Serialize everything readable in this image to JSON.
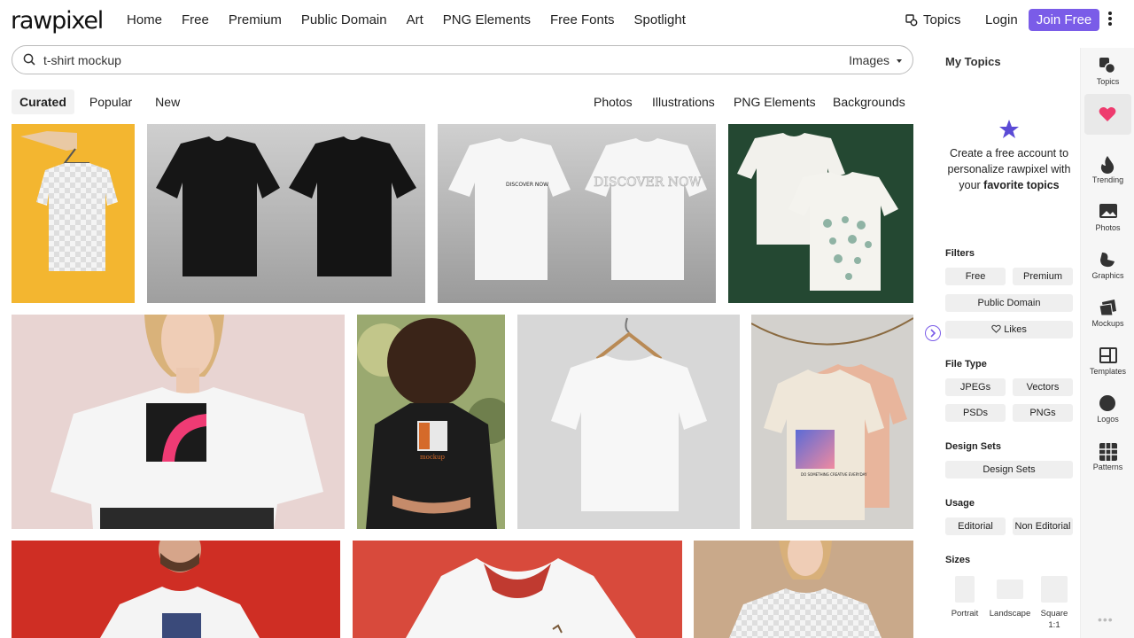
{
  "header": {
    "logo": "rawpixel",
    "nav": [
      "Home",
      "Free",
      "Premium",
      "Public Domain",
      "Art",
      "PNG Elements",
      "Free Fonts",
      "Spotlight"
    ],
    "topics": "Topics",
    "login": "Login",
    "join": "Join Free"
  },
  "search": {
    "query": "t-shirt mockup",
    "type": "Images"
  },
  "tabs": [
    {
      "label": "Curated",
      "active": true
    },
    {
      "label": "Popular",
      "active": false
    },
    {
      "label": "New",
      "active": false
    }
  ],
  "content_types": [
    "Photos",
    "Illustrations",
    "PNG Elements",
    "Backgrounds"
  ],
  "images": {
    "print_discover_small": "DISCOVER NOW",
    "print_discover": "DISCOVER NOW",
    "print_mockup": "mockup",
    "print_do_something": "DO SOMETHING CREATIVE EVERYDAY"
  },
  "sidebar": {
    "my_topics": "My Topics",
    "cta_line1": "Create a free account to",
    "cta_line2": "personalize rawpixel with",
    "cta_line3_pre": "your ",
    "cta_line3_bold": "favorite topics",
    "filters_title": "Filters",
    "filters": [
      "Free",
      "Premium",
      "Public Domain",
      "Likes"
    ],
    "file_type_title": "File Type",
    "file_types": [
      "JPEGs",
      "Vectors",
      "PSDs",
      "PNGs"
    ],
    "design_sets_title": "Design Sets",
    "design_sets": "Design Sets",
    "usage_title": "Usage",
    "usage": [
      "Editorial",
      "Non Editorial"
    ],
    "sizes_title": "Sizes",
    "sizes": [
      "Portrait",
      "Landscape",
      "Square"
    ],
    "square_ratio": "1:1"
  },
  "rail": [
    "Topics",
    "",
    "Trending",
    "Photos",
    "Graphics",
    "Mockups",
    "Templates",
    "Logos",
    "Patterns"
  ],
  "colors": {
    "accent": "#7a5ce8",
    "heart": "#ee3b6e"
  }
}
